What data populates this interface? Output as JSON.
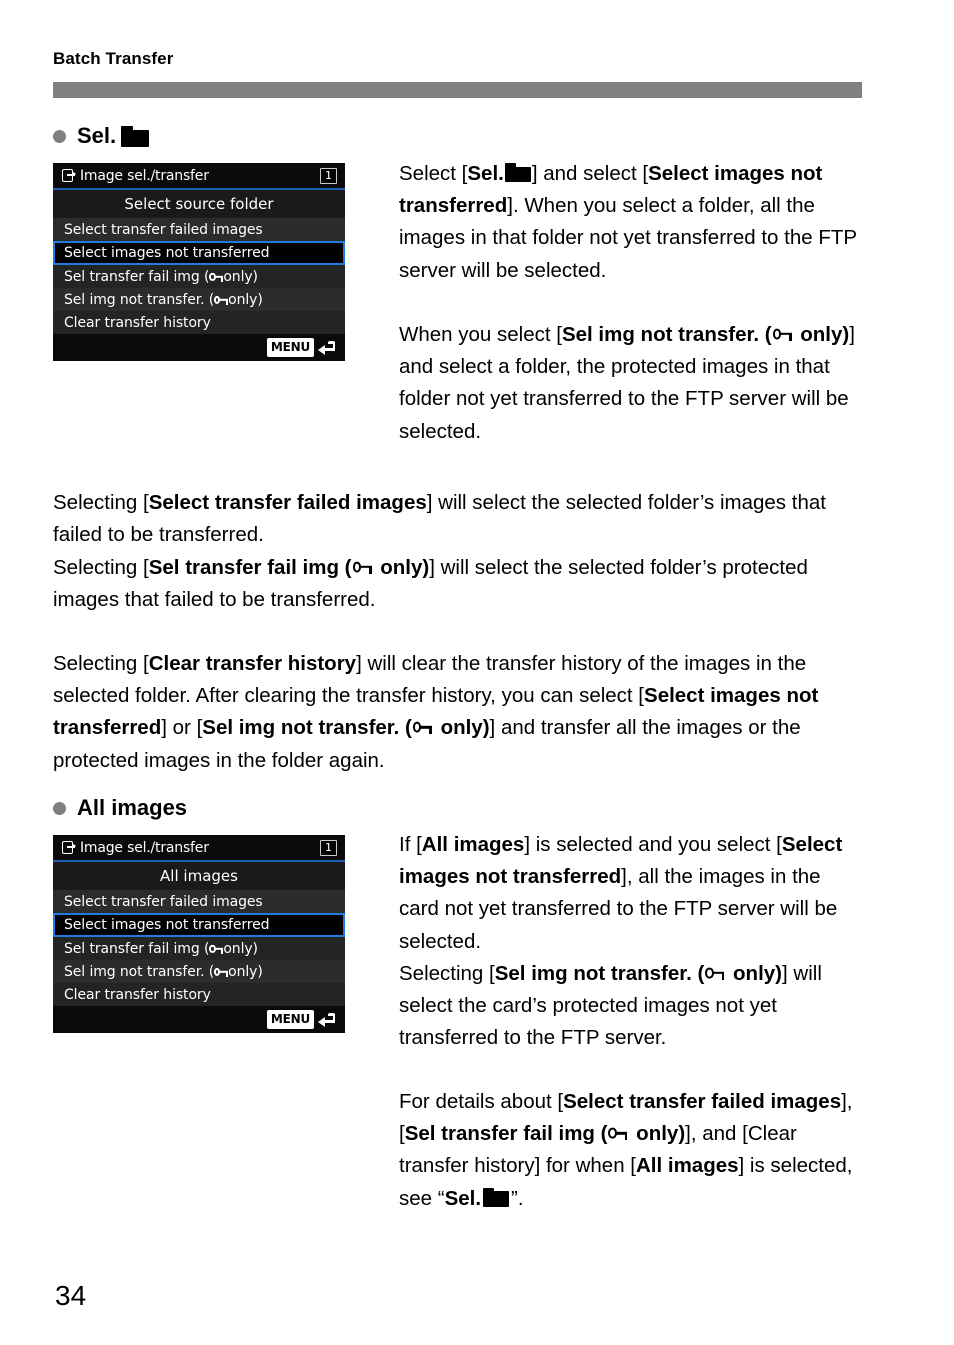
{
  "page": {
    "running_head": "Batch Transfer",
    "page_number": "34",
    "rule_color": "#808080"
  },
  "sections": [
    {
      "heading": "Sel.",
      "heading_has_folder_icon": true,
      "bullet_color": "#808080",
      "menu": {
        "title": "Image sel./transfer",
        "card_badge": "1",
        "subtitle": "Select source folder",
        "accent_color": "#1f7ae0",
        "title_underline_color": "#1b5fb0",
        "rows": [
          {
            "label": "Select transfer failed images",
            "selected": false,
            "protected_only": false
          },
          {
            "label": "Select images not transferred",
            "selected": true,
            "protected_only": false
          },
          {
            "label": "Sel transfer fail img (",
            "label_tail": " only)",
            "selected": false,
            "protected_only": true
          },
          {
            "label": "Sel img not transfer. (",
            "label_tail": " only)",
            "selected": false,
            "protected_only": true
          },
          {
            "label": "Clear transfer history",
            "selected": false,
            "protected_only": false
          }
        ],
        "footer_button": "MENU"
      }
    },
    {
      "heading": "All images",
      "heading_has_folder_icon": false,
      "bullet_color": "#808080",
      "menu": {
        "title": "Image sel./transfer",
        "card_badge": "1",
        "subtitle": "All images",
        "accent_color": "#1f7ae0",
        "title_underline_color": "#1b5fb0",
        "rows": [
          {
            "label": "Select transfer failed images",
            "selected": false,
            "protected_only": false
          },
          {
            "label": "Select images not transferred",
            "selected": true,
            "protected_only": false
          },
          {
            "label": "Sel transfer fail img (",
            "label_tail": " only)",
            "selected": false,
            "protected_only": true
          },
          {
            "label": "Sel img not transfer. (",
            "label_tail": " only)",
            "selected": false,
            "protected_only": true
          },
          {
            "label": "Clear transfer history",
            "selected": false,
            "protected_only": false
          }
        ],
        "footer_button": "MENU"
      }
    }
  ],
  "paragraphs": {
    "sel_right_1a": "Select [",
    "sel_right_1b": "Sel.",
    "sel_right_1c": "] and select [",
    "sel_right_1d": "Select images not transferred",
    "sel_right_1e": "]. When you select a folder, all the images in that folder not yet transferred to the FTP server will be selected.",
    "sel_right_2a": "When you select [",
    "sel_right_2b": "Sel img not transfer. (",
    "sel_right_2c": " only)",
    "sel_right_2d": "] and select a folder, the protected images in that folder not yet transferred to the FTP server will be selected.",
    "mid_1a": "Selecting [",
    "mid_1b": "Select transfer failed images",
    "mid_1c": "] will select the selected folder’s images that failed to be transferred.",
    "mid_2a": "Selecting [",
    "mid_2b": "Sel transfer fail img (",
    "mid_2c": " only)",
    "mid_2d": "] will select the selected folder’s protected images that failed to be transferred.",
    "mid_3a": "Selecting [",
    "mid_3b": "Clear transfer history",
    "mid_3c": "] will clear the transfer history of the images in the selected folder. After clearing the transfer history, you can select [",
    "mid_3d": "Select images not transferred",
    "mid_3e": "] or [",
    "mid_3f": "Sel img not transfer. (",
    "mid_3g": " only)",
    "mid_3h": "] and transfer all the images or the protected images in the folder again.",
    "all_right_1a": "If [",
    "all_right_1b": "All images",
    "all_right_1c": "] is selected and you select [",
    "all_right_1d": "Select images not transferred",
    "all_right_1e": "], all the images in the card not yet transferred to the FTP server will be selected.",
    "all_right_2a": "Selecting [",
    "all_right_2b": "Sel img not transfer. (",
    "all_right_2c": " only)",
    "all_right_2d": "] will select the card’s protected images not yet transferred to the FTP server.",
    "all_right_3a": "For details about [",
    "all_right_3b": "Select transfer failed images",
    "all_right_3c": "], [",
    "all_right_3d": "Sel transfer fail img (",
    "all_right_3e": " only)",
    "all_right_3f": "], and [Clear transfer history] for when [",
    "all_right_3g": "All images",
    "all_right_3h": "] is selected, see “",
    "all_right_3i": "Sel.",
    "all_right_3j": "”."
  }
}
